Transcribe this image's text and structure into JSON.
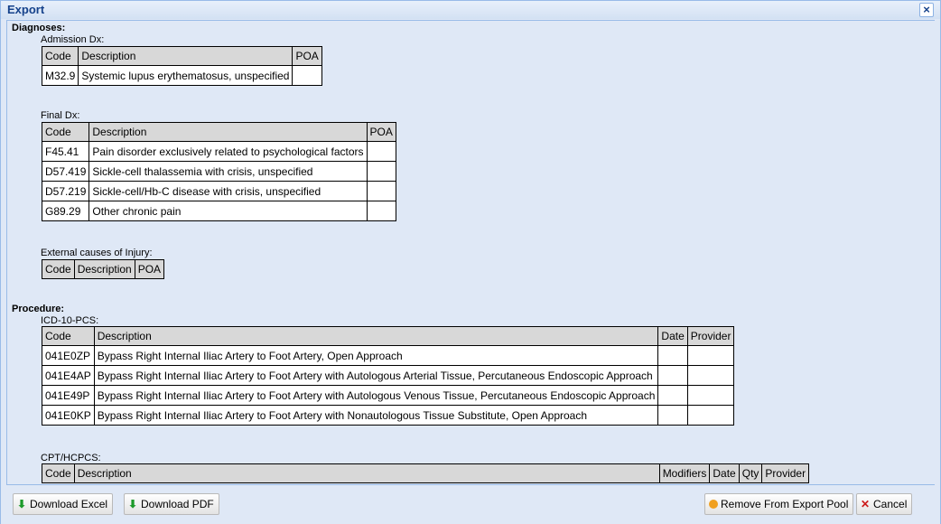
{
  "window": {
    "title": "Export",
    "close_symbol": "×"
  },
  "diagnoses": {
    "heading": "Diagnoses:",
    "admission": {
      "label": "Admission Dx:",
      "headers": [
        "Code",
        "Description",
        "POA"
      ],
      "rows": [
        [
          "M32.9",
          "Systemic lupus erythematosus, unspecified",
          ""
        ]
      ]
    },
    "final": {
      "label": "Final Dx:",
      "headers": [
        "Code",
        "Description",
        "POA"
      ],
      "rows": [
        [
          "F45.41",
          "Pain disorder exclusively related to psychological factors",
          ""
        ],
        [
          "D57.419",
          "Sickle-cell thalassemia with crisis, unspecified",
          ""
        ],
        [
          "D57.219",
          "Sickle-cell/Hb-C disease with crisis, unspecified",
          ""
        ],
        [
          "G89.29",
          "Other chronic pain",
          ""
        ]
      ]
    },
    "external": {
      "label": "External causes of Injury:",
      "headers": [
        "Code",
        "Description",
        "POA"
      ]
    }
  },
  "procedure": {
    "heading": "Procedure:",
    "icd10pcs": {
      "label": "ICD-10-PCS:",
      "headers": [
        "Code",
        "Description",
        "Date",
        "Provider"
      ],
      "rows": [
        [
          "041E0ZP",
          "Bypass Right Internal Iliac Artery to Foot Artery, Open Approach",
          "",
          ""
        ],
        [
          "041E4AP",
          "Bypass Right Internal Iliac Artery to Foot Artery with Autologous Arterial Tissue, Percutaneous Endoscopic Approach",
          "",
          ""
        ],
        [
          "041E49P",
          "Bypass Right Internal Iliac Artery to Foot Artery with Autologous Venous Tissue, Percutaneous Endoscopic Approach",
          "",
          ""
        ],
        [
          "041E0KP",
          "Bypass Right Internal Iliac Artery to Foot Artery with Nonautologous Tissue Substitute, Open Approach",
          "",
          ""
        ]
      ]
    },
    "cpt": {
      "label": "CPT/HCPCS:",
      "headers": [
        "Code",
        "Description",
        "Modifiers",
        "Date",
        "Qty",
        "Provider"
      ]
    }
  },
  "footer": {
    "download_excel": "Download Excel",
    "download_pdf": "Download PDF",
    "remove": "Remove From Export Pool",
    "cancel": "Cancel"
  },
  "icons": {
    "close": "close-icon",
    "download": "download-arrow-icon",
    "remove": "remove-icon",
    "cancel": "cancel-x-icon"
  }
}
